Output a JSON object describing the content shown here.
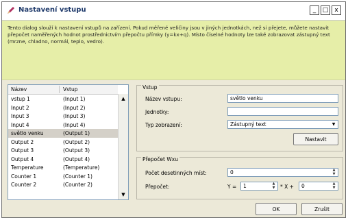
{
  "window": {
    "title": "Nastavení vstupu",
    "controls": {
      "minimize": "_",
      "maximize": "□",
      "close": "x"
    }
  },
  "info_text": "Tento dialog slouží k nastavení vstupů na zařízení. Pokud měřené veličiny jsou v jiných jednotkách, než si přejete, můžete nastavit přepočet naměřených hodnot prostřednictvím přepočtu přímky (y=kx+q). Místo číselné hodnoty lze také zobrazovat zástupný text (mrzne, chladno, normál, teplo, vedro).",
  "list": {
    "headers": {
      "col1": "Název",
      "col2": "Vstup"
    },
    "rows": [
      {
        "name": "vstup 1",
        "input": "(Input 1)"
      },
      {
        "name": "Input 2",
        "input": "(Input 2)"
      },
      {
        "name": "Input 3",
        "input": "(Input 3)"
      },
      {
        "name": "Input 4",
        "input": "(Input 4)"
      },
      {
        "name": "světlo venku",
        "input": "(Output 1)"
      },
      {
        "name": "Output 2",
        "input": "(Output 2)"
      },
      {
        "name": "Output 3",
        "input": "(Output 3)"
      },
      {
        "name": "Output 4",
        "input": "(Output 4)"
      },
      {
        "name": "Temperature",
        "input": "(Temperature)"
      },
      {
        "name": "Counter 1",
        "input": "(Counter 1)"
      },
      {
        "name": "Counter 2",
        "input": "(Counter 2)"
      }
    ]
  },
  "vstup_group": {
    "title": "Vstup",
    "name_label": "Název vstupu:",
    "name_value": "světlo venku",
    "units_label": "Jednotky:",
    "units_value": "",
    "display_label": "Typ zobrazení:",
    "display_value": "Zástupný text",
    "set_button": "Nastavit"
  },
  "prepocet_group": {
    "title": "Přepočet Wxu",
    "decimals_label": "Počet desetinných míst:",
    "decimals_value": "0",
    "conversion_label": "Přepočet:",
    "y_prefix": "Y =",
    "k_value": "1",
    "x_mid": "* X +",
    "q_value": "0"
  },
  "buttons": {
    "ok": "OK",
    "cancel": "Zrušit"
  }
}
